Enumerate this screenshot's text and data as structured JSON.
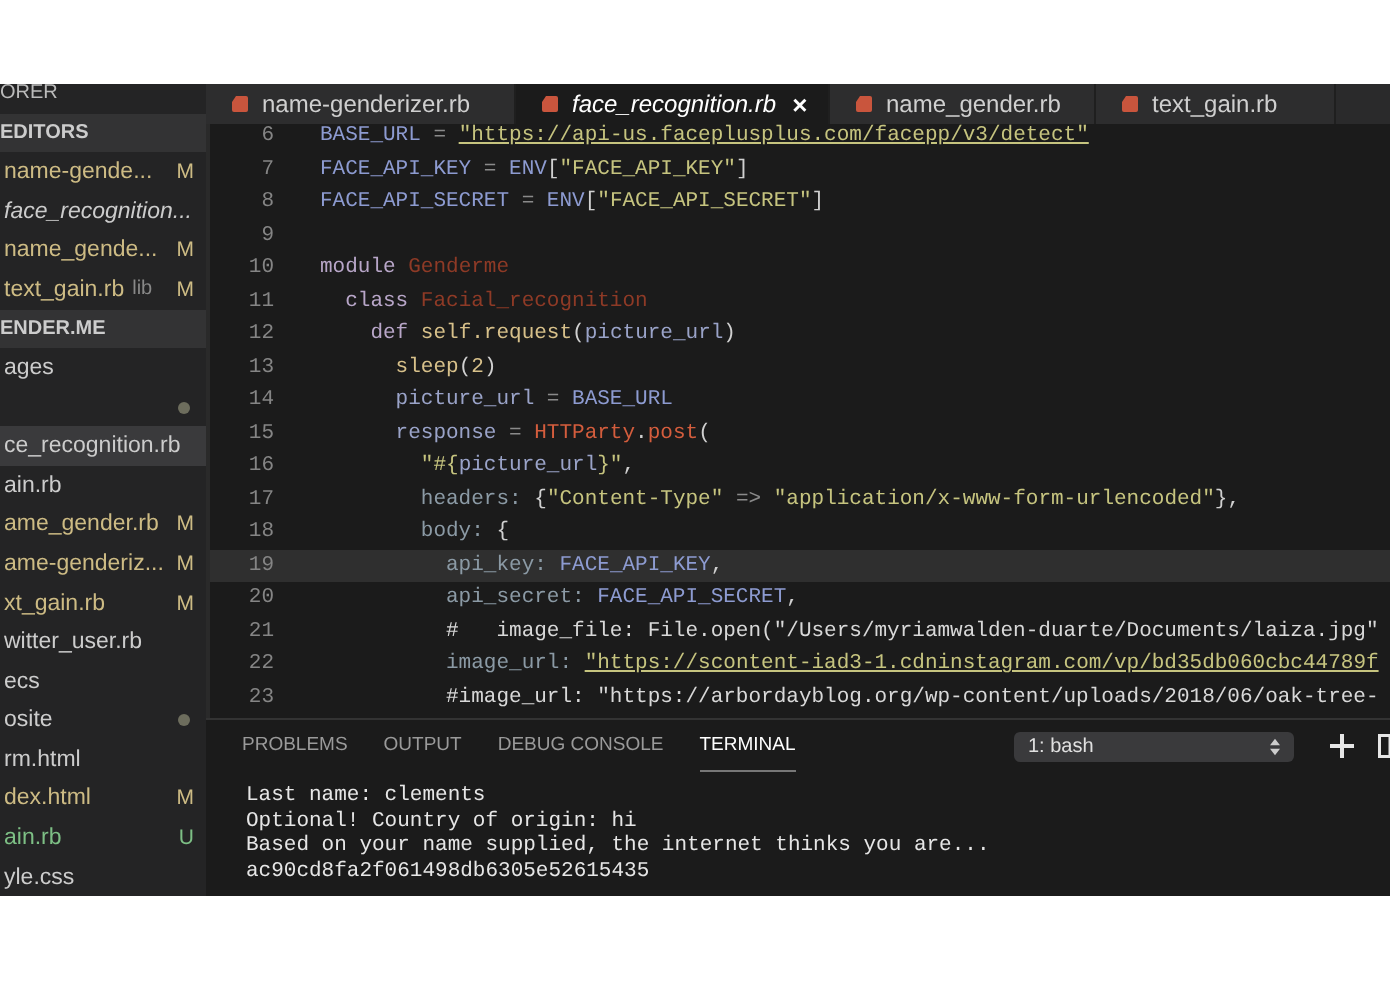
{
  "sidebar": {
    "items": [
      {
        "kind": "section",
        "label": "ORER"
      },
      {
        "kind": "group",
        "label": "EDITORS"
      },
      {
        "kind": "file",
        "label": "name-gende...",
        "color": "#cdbb84",
        "badge": "M",
        "dot": false,
        "preview": false,
        "selected": false
      },
      {
        "kind": "file",
        "label": "face_recognition...",
        "dot": false,
        "preview": true,
        "selected": false
      },
      {
        "kind": "file",
        "label": "name_gende...",
        "color": "#cdbb84",
        "badge": "M",
        "dot": false,
        "preview": false,
        "selected": false
      },
      {
        "kind": "file",
        "label": "text_gain.rb",
        "description": "lib",
        "color": "#cdbb84",
        "badge": "M",
        "dot": false,
        "preview": false,
        "selected": false
      },
      {
        "kind": "group",
        "label": "ENDER.ME"
      },
      {
        "kind": "file",
        "label": "ages",
        "dot": false,
        "preview": false,
        "selected": false
      },
      {
        "kind": "file",
        "dot": true,
        "selected": false
      },
      {
        "kind": "file",
        "label": "ce_recognition.rb",
        "dot": false,
        "preview": false,
        "selected": true
      },
      {
        "kind": "file",
        "label": "ain.rb",
        "dot": false,
        "preview": false,
        "selected": false
      },
      {
        "kind": "file",
        "label": "ame_gender.rb",
        "color": "#cdbb84",
        "badge": "M",
        "dot": false,
        "preview": false,
        "selected": false
      },
      {
        "kind": "file",
        "label": "ame-genderiz...",
        "color": "#cdbb84",
        "badge": "M",
        "dot": false,
        "preview": false,
        "selected": false
      },
      {
        "kind": "file",
        "label": "xt_gain.rb",
        "color": "#cdbb84",
        "badge": "M",
        "dot": false,
        "preview": false,
        "selected": false
      },
      {
        "kind": "file",
        "label": "witter_user.rb",
        "dot": false,
        "preview": false,
        "selected": false
      },
      {
        "kind": "file",
        "label": "ecs",
        "dot": false,
        "preview": false,
        "selected": false
      },
      {
        "kind": "file",
        "label": "osite",
        "dot": true,
        "preview": false,
        "selected": false
      },
      {
        "kind": "file",
        "label": "rm.html",
        "dot": false,
        "preview": false,
        "selected": false
      },
      {
        "kind": "file",
        "label": "dex.html",
        "color": "#cdbb84",
        "badge": "M",
        "dot": false,
        "preview": false,
        "selected": false
      },
      {
        "kind": "file",
        "label": "ain.rb",
        "color": "#7dbf85",
        "badge": "U",
        "dot": false,
        "preview": false,
        "selected": false
      },
      {
        "kind": "file",
        "label": "yle.css",
        "dot": false,
        "preview": false,
        "selected": false
      }
    ]
  },
  "tabs": [
    {
      "label": "name-genderizer.rb",
      "selected": false,
      "close": false
    },
    {
      "label": "face_recognition.rb",
      "selected": true,
      "close": true,
      "close_glyph": "×"
    },
    {
      "label": "name_gender.rb",
      "selected": false,
      "close": false
    },
    {
      "label": "text_gain.rb",
      "selected": false,
      "close": false
    }
  ],
  "editor": {
    "lines": [
      {
        "number": "6",
        "current": false,
        "tokens": [
          {
            "text": "BASE_URL",
            "kind": "const"
          },
          {
            "text": " = ",
            "kind": "op"
          },
          {
            "text": "\"https://api-us.faceplusplus.com/facepp/v3/detect\"",
            "kind": "link"
          }
        ]
      },
      {
        "number": "7",
        "current": false,
        "tokens": [
          {
            "text": "FACE_API_KEY",
            "kind": "const"
          },
          {
            "text": " = ",
            "kind": "op"
          },
          {
            "text": "ENV",
            "kind": "const"
          },
          {
            "text": "[",
            "kind": "punct"
          },
          {
            "text": "\"FACE_API_KEY\"",
            "kind": "string"
          },
          {
            "text": "]",
            "kind": "punct"
          }
        ]
      },
      {
        "number": "8",
        "current": false,
        "tokens": [
          {
            "text": "FACE_API_SECRET",
            "kind": "const"
          },
          {
            "text": " = ",
            "kind": "op"
          },
          {
            "text": "ENV",
            "kind": "const"
          },
          {
            "text": "[",
            "kind": "punct"
          },
          {
            "text": "\"FACE_API_SECRET\"",
            "kind": "string"
          },
          {
            "text": "]",
            "kind": "punct"
          }
        ]
      },
      {
        "number": "9",
        "current": false
      },
      {
        "number": "10",
        "current": false,
        "tokens": [
          {
            "text": "module ",
            "kind": "keyword"
          },
          {
            "text": "Genderme",
            "kind": "class"
          }
        ]
      },
      {
        "number": "11",
        "current": false,
        "tokens": [
          {
            "text": "  class ",
            "kind": "keyword"
          },
          {
            "text": "Facial_recognition",
            "kind": "class"
          }
        ]
      },
      {
        "number": "12",
        "current": false,
        "tokens": [
          {
            "text": "    def ",
            "kind": "keyword"
          },
          {
            "text": "self.request",
            "kind": "method"
          },
          {
            "text": "(",
            "kind": "punct"
          },
          {
            "text": "picture_url",
            "kind": "var"
          },
          {
            "text": ")",
            "kind": "punct"
          }
        ]
      },
      {
        "number": "13",
        "current": false,
        "tokens": [
          {
            "text": "      sleep",
            "kind": "method"
          },
          {
            "text": "(",
            "kind": "punct"
          },
          {
            "text": "2",
            "kind": "number"
          },
          {
            "text": ")",
            "kind": "punct"
          }
        ]
      },
      {
        "number": "14",
        "current": false,
        "tokens": [
          {
            "text": "      picture_url",
            "kind": "var"
          },
          {
            "text": " = ",
            "kind": "op"
          },
          {
            "text": "BASE_URL",
            "kind": "const"
          }
        ]
      },
      {
        "number": "15",
        "current": false,
        "tokens": [
          {
            "text": "      response",
            "kind": "var"
          },
          {
            "text": " = ",
            "kind": "op"
          },
          {
            "text": "HTTParty",
            "kind": "call"
          },
          {
            "text": ".",
            "kind": "punct"
          },
          {
            "text": "post",
            "kind": "call"
          },
          {
            "text": "(",
            "kind": "punct"
          }
        ]
      },
      {
        "number": "16",
        "current": false,
        "tokens": [
          {
            "text": "        \"#{",
            "kind": "string"
          },
          {
            "text": "picture_url",
            "kind": "var"
          },
          {
            "text": "}\"",
            "kind": "string"
          },
          {
            "text": ",",
            "kind": "punct"
          }
        ]
      },
      {
        "number": "17",
        "current": false,
        "tokens": [
          {
            "text": "        headers:",
            "kind": "symbol"
          },
          {
            "text": " {",
            "kind": "punct"
          },
          {
            "text": "\"Content-Type\"",
            "kind": "string"
          },
          {
            "text": " => ",
            "kind": "op"
          },
          {
            "text": "\"application/x-www-form-urlencoded\"",
            "kind": "string"
          },
          {
            "text": "},",
            "kind": "punct"
          }
        ]
      },
      {
        "number": "18",
        "current": false,
        "tokens": [
          {
            "text": "        body:",
            "kind": "symbol"
          },
          {
            "text": " {",
            "kind": "punct"
          }
        ]
      },
      {
        "number": "19",
        "current": true,
        "tokens": [
          {
            "text": "          api_key: ",
            "kind": "symbol"
          },
          {
            "text": "FACE_API_KEY",
            "kind": "const"
          },
          {
            "text": ",",
            "kind": "punct"
          }
        ]
      },
      {
        "number": "20",
        "current": false,
        "tokens": [
          {
            "text": "          api_secret: ",
            "kind": "symbol"
          },
          {
            "text": "FACE_API_SECRET",
            "kind": "const"
          },
          {
            "text": ",",
            "kind": "punct"
          }
        ]
      },
      {
        "number": "21",
        "current": false,
        "tokens": [
          {
            "text": "          #   image_file: File.open(\"/Users/myriamwalden-duarte/Documents/laiza.jpg\"",
            "kind": "comment"
          }
        ]
      },
      {
        "number": "22",
        "current": false,
        "tokens": [
          {
            "text": "          image_url: ",
            "kind": "symbol"
          },
          {
            "text": "\"https://scontent-iad3-1.cdninstagram.com/vp/bd35db060cbc44789f",
            "kind": "link"
          }
        ]
      },
      {
        "number": "23",
        "current": false,
        "tokens": [
          {
            "text": "          #image_url: \"https://arbordayblog.org/wp-content/uploads/2018/06/oak-tree-",
            "kind": "comment"
          }
        ]
      }
    ]
  },
  "panel": {
    "tabs": [
      {
        "label": "PROBLEMS",
        "selected": false
      },
      {
        "label": "OUTPUT",
        "selected": false
      },
      {
        "label": "DEBUG CONSOLE",
        "selected": false
      },
      {
        "label": "TERMINAL",
        "selected": true
      }
    ],
    "terminal_select": "1: bash",
    "terminal_lines": [
      "Last name: clements",
      "Optional! Country of origin: hi",
      "Based on your name supplied, the internet thinks you are...",
      "ac90cd8fa2f061498db6305e52615435"
    ]
  }
}
